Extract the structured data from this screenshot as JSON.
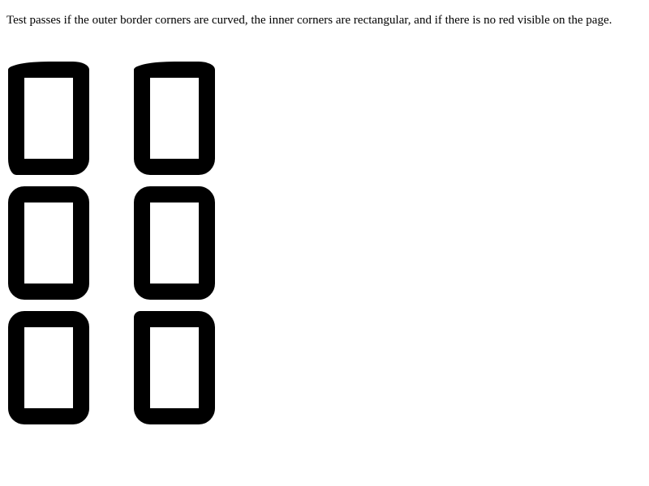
{
  "instructions": "Test passes if the outer border corners are curved, the inner corners are rectangular, and if there is no red visible on the page.",
  "colors": {
    "border": "#000000",
    "background": "#ffffff"
  },
  "boxes": [
    {
      "id": 1
    },
    {
      "id": 2
    },
    {
      "id": 3
    },
    {
      "id": 4
    },
    {
      "id": 5
    },
    {
      "id": 6
    }
  ]
}
